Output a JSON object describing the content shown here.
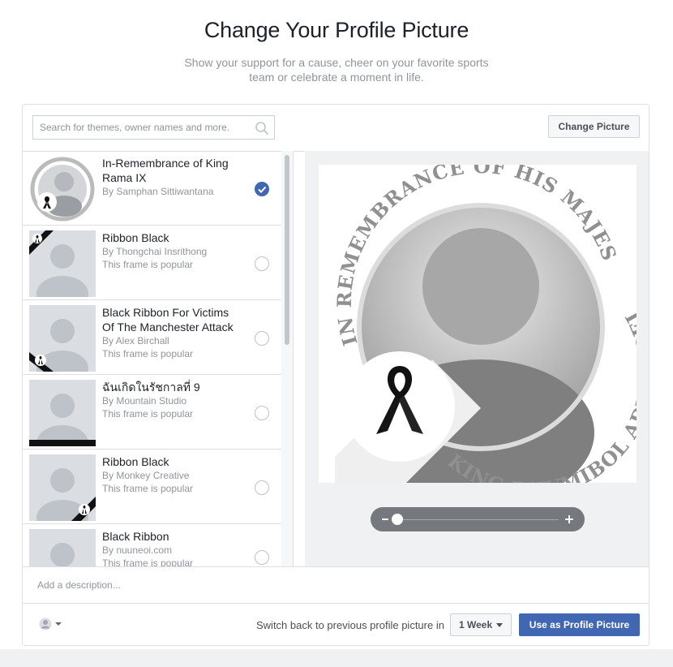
{
  "header": {
    "title": "Change Your Profile Picture",
    "subtitle": "Show your support for a cause, cheer on your favorite sports team or celebrate a moment in life."
  },
  "search": {
    "placeholder": "Search for themes, owner names and more.",
    "icon": "search-icon"
  },
  "toolbar": {
    "change_picture_label": "Change Picture"
  },
  "frames": [
    {
      "name": "In-Remembrance of King Rama IX",
      "owner": "By Samphan Sittiwantana",
      "popular": "",
      "selected": true
    },
    {
      "name": "Ribbon Black",
      "owner": "By Thongchai Insrithong",
      "popular": "This frame is popular",
      "selected": false
    },
    {
      "name": "Black Ribbon For Victims Of The Manchester Attack",
      "owner": "By Alex Birchall",
      "popular": "This frame is popular",
      "selected": false
    },
    {
      "name": "ฉันเกิดในรัชกาลที่ 9",
      "owner": "By Mountain Studio",
      "popular": "This frame is popular",
      "selected": false
    },
    {
      "name": "Ribbon Black",
      "owner": "By Monkey Creative",
      "popular": "This frame is popular",
      "selected": false
    },
    {
      "name": "Black Ribbon",
      "owner": "By nuuneoi.com",
      "popular": "This frame is popular",
      "selected": false
    }
  ],
  "preview": {
    "arc_top": "IN REMEMBRANCE OF HIS MAJESTY",
    "arc_bottom": "KING BHUMIBOL ADULYADEJ"
  },
  "description": {
    "placeholder": "Add a description..."
  },
  "footer": {
    "switch_back_text": "Switch back to previous profile picture in",
    "duration_value": "1 Week",
    "use_button_label": "Use as Profile Picture",
    "privacy_icon": "avatar-icon"
  },
  "colors": {
    "primary": "#4267b2",
    "text": "#1d2129",
    "muted": "#90949c",
    "border": "#dddfe2"
  }
}
